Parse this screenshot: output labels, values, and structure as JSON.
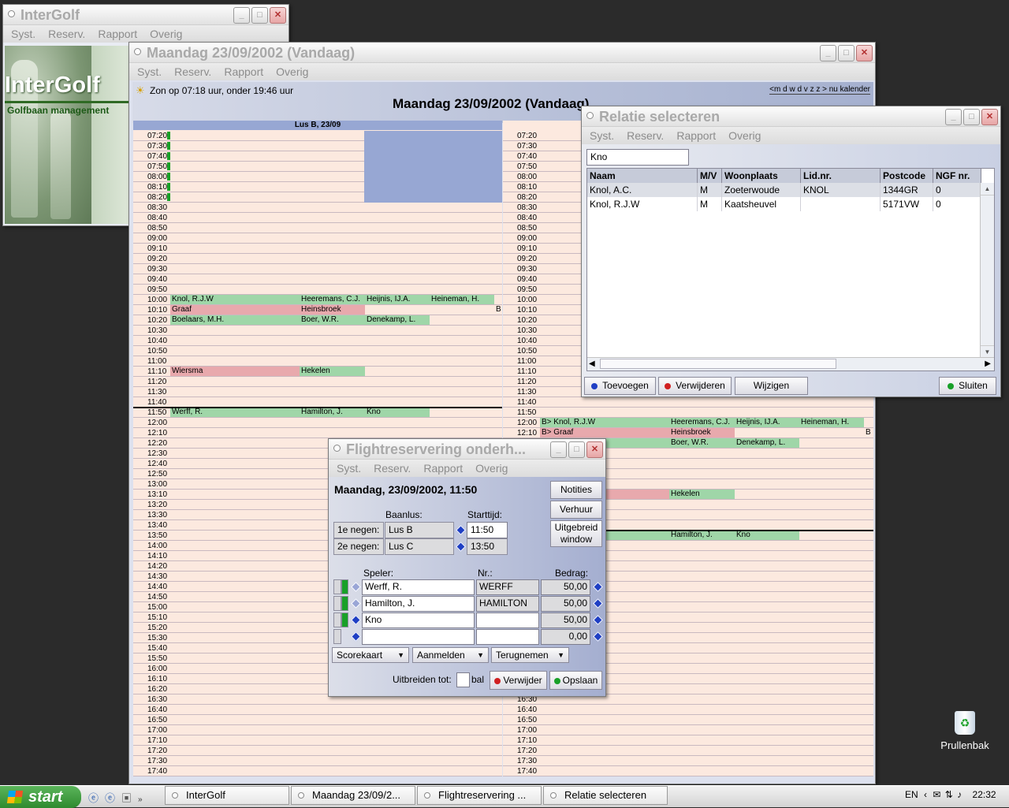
{
  "main_window": {
    "title": "Maandag 23/09/2002 (Vandaag)",
    "menu": [
      "Syst.",
      "Reserv.",
      "Rapport",
      "Overig"
    ],
    "sun_text": "Zon op 07:18 uur, onder 19:46 uur",
    "date_nav": "<m d w d v z z > nu kalender",
    "heading": "Maandag 23/09/2002 (Vandaag)",
    "left_col_header": "Lus B, 23/09"
  },
  "times": [
    "07:20",
    "07:30",
    "07:40",
    "07:50",
    "08:00",
    "08:10",
    "08:20",
    "08:30",
    "08:40",
    "08:50",
    "09:00",
    "09:10",
    "09:20",
    "09:30",
    "09:40",
    "09:50",
    "10:00",
    "10:10",
    "10:20",
    "10:30",
    "10:40",
    "10:50",
    "11:00",
    "11:10",
    "11:20",
    "11:30",
    "11:40",
    "11:50",
    "12:00",
    "12:10",
    "12:20",
    "12:30",
    "12:40",
    "12:50",
    "13:00",
    "13:10",
    "13:20",
    "13:30",
    "13:40",
    "13:50",
    "14:00",
    "14:10",
    "14:20",
    "14:30",
    "14:40",
    "14:50",
    "15:00",
    "15:10",
    "15:20",
    "15:30",
    "15:40",
    "15:50",
    "16:00",
    "16:10",
    "16:20",
    "16:30",
    "16:40",
    "16:50",
    "17:00",
    "17:10",
    "17:20",
    "17:30",
    "17:40"
  ],
  "left_bookings": [
    {
      "time": "10:00",
      "cells": [
        {
          "text": "Knol, R.J.W",
          "color": "#9fd6a8"
        },
        {
          "text": "Heeremans, C.J.",
          "color": "#9fd6a8"
        },
        {
          "text": "Heijnis, IJ.A.",
          "color": "#9fd6a8"
        },
        {
          "text": "Heineman, H.",
          "color": "#9fd6a8"
        }
      ]
    },
    {
      "time": "10:10",
      "cells": [
        {
          "text": "Graaf",
          "color": "#e8a9ad"
        },
        {
          "text": "Heinsbroek",
          "color": "#e8a9ad"
        }
      ],
      "tail": "B"
    },
    {
      "time": "10:20",
      "cells": [
        {
          "text": "Boelaars, M.H.",
          "color": "#9fd6a8"
        },
        {
          "text": "Boer, W.R.",
          "color": "#9fd6a8"
        },
        {
          "text": "Denekamp, L.",
          "color": "#9fd6a8"
        }
      ]
    },
    {
      "time": "11:10",
      "cells": [
        {
          "text": "Wiersma",
          "color": "#e8a9ad"
        },
        {
          "text": "Hekelen",
          "color": "#9fd6a8"
        }
      ]
    },
    {
      "time": "11:50",
      "cells": [
        {
          "text": "Werff, R.",
          "color": "#9fd6a8"
        },
        {
          "text": "Hamilton, J.",
          "color": "#9fd6a8"
        },
        {
          "text": "Kno",
          "color": "#9fd6a8"
        }
      ]
    }
  ],
  "right_bookings": [
    {
      "time": "12:00",
      "cells": [
        {
          "text": "B> Knol, R.J.W",
          "color": "#9fd6a8"
        },
        {
          "text": "Heeremans, C.J.",
          "color": "#9fd6a8"
        },
        {
          "text": "Heijnis, IJ.A.",
          "color": "#9fd6a8"
        },
        {
          "text": "Heineman, H.",
          "color": "#9fd6a8"
        }
      ]
    },
    {
      "time": "12:10",
      "cells": [
        {
          "text": "B> Graaf",
          "color": "#e8a9ad"
        },
        {
          "text": "Heinsbroek",
          "color": "#e8a9ad"
        }
      ],
      "tail": "B"
    },
    {
      "time": "12:20",
      "cells": [
        {
          "text": "",
          "color": "#9fd6a8"
        },
        {
          "text": "Boer, W.R.",
          "color": "#9fd6a8"
        },
        {
          "text": "Denekamp, L.",
          "color": "#9fd6a8"
        }
      ]
    },
    {
      "time": "13:10",
      "cells": [
        {
          "text": "",
          "color": "#e8a9ad"
        },
        {
          "text": "Hekelen",
          "color": "#9fd6a8"
        }
      ]
    },
    {
      "time": "13:50",
      "cells": [
        {
          "text": "",
          "color": "#9fd6a8"
        },
        {
          "text": "Hamilton, J.",
          "color": "#9fd6a8"
        },
        {
          "text": "Kno",
          "color": "#9fd6a8"
        }
      ]
    }
  ],
  "intergolf_window": {
    "title": "InterGolf",
    "menu": [
      "Syst.",
      "Reserv.",
      "Rapport",
      "Overig"
    ],
    "logo": "InterGolf",
    "tagline": "Golfbaan management"
  },
  "relatie_window": {
    "title": "Relatie selecteren",
    "menu": [
      "Syst.",
      "Reserv.",
      "Rapport",
      "Overig"
    ],
    "search": "Kno",
    "columns": [
      "Naam",
      "M/V",
      "Woonplaats",
      "Lid.nr.",
      "Postcode",
      "NGF nr."
    ],
    "rows": [
      [
        "Knol, A.C.",
        "M",
        "Zoeterwoude",
        "KNOL",
        "1344GR",
        "0"
      ],
      [
        "Knol, R.J.W",
        "M",
        "Kaatsheuvel",
        "",
        "5171VW",
        "0"
      ]
    ],
    "buttons": {
      "add": "Toevoegen",
      "remove": "Verwijderen",
      "edit": "Wijzigen",
      "close": "Sluiten"
    }
  },
  "flight_window": {
    "title": "Flightreservering onderh...",
    "menu": [
      "Syst.",
      "Reserv.",
      "Rapport",
      "Overig"
    ],
    "date": "Maandag, 23/09/2002, 11:50",
    "baanlus_label": "Baanlus:",
    "starttijd_label": "Starttijd:",
    "first_nine_label": "1e negen:",
    "first_nine_loop": "Lus B",
    "first_nine_time": "11:50",
    "second_nine_label": "2e negen:",
    "second_nine_loop": "Lus C",
    "second_nine_time": "13:50",
    "notities": "Notities",
    "verhuur": "Verhuur",
    "uitgebreid": "Uitgebreid window",
    "speler_label": "Speler:",
    "nr_label": "Nr.:",
    "bedrag_label": "Bedrag:",
    "players": [
      {
        "name": "Werff, R.",
        "nr": "WERFF",
        "amount": "50,00"
      },
      {
        "name": "Hamilton, J.",
        "nr": "HAMILTON",
        "amount": "50,00"
      },
      {
        "name": "Kno",
        "nr": "",
        "amount": "50,00"
      },
      {
        "name": "",
        "nr": "",
        "amount": "0,00"
      }
    ],
    "scorekaart": "Scorekaart",
    "aanmelden": "Aanmelden",
    "terugnemen": "Terugnemen",
    "uitbreiden_label": "Uitbreiden tot:",
    "bal_label": "bal",
    "verwijder": "Verwijder",
    "opslaan": "Opslaan"
  },
  "desktop": {
    "recycle_bin": "Prullenbak"
  },
  "taskbar": {
    "start": "start",
    "tasks": [
      "InterGolf",
      "Maandag 23/09/2...",
      "Flightreservering ...",
      "Relatie selecteren"
    ],
    "lang": "EN",
    "clock": "22:32"
  }
}
